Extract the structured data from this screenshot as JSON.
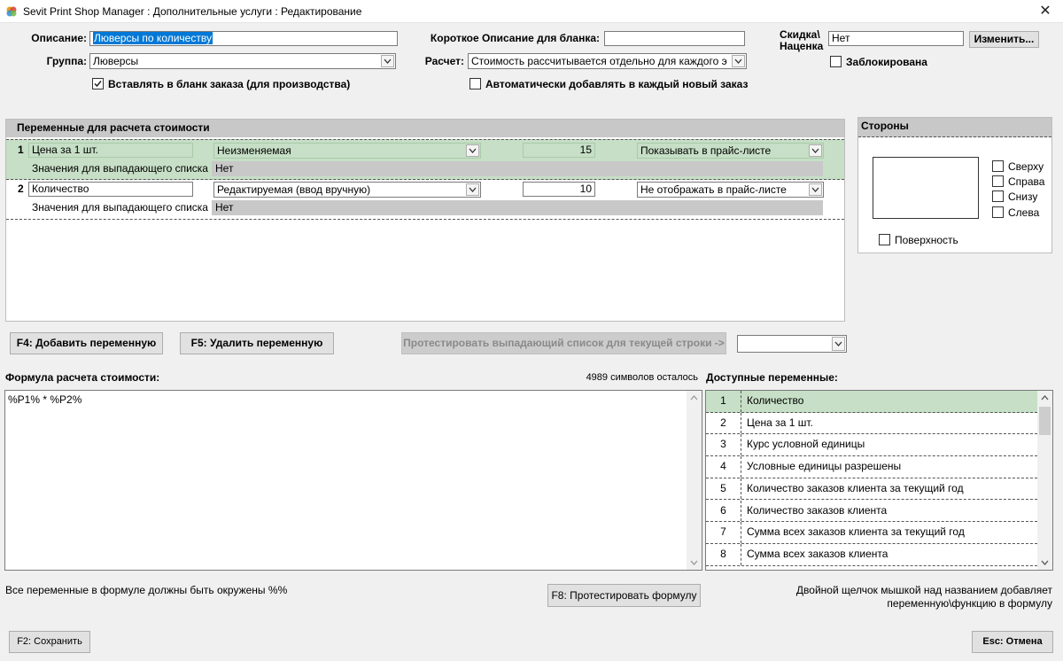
{
  "window": {
    "title": "Sevit Print Shop Manager : Дополнительные услуги : Редактирование",
    "close_glyph": "✕"
  },
  "form": {
    "description_label": "Описание:",
    "description_value": "Люверсы по количеству",
    "group_label": "Группа:",
    "group_value": "Люверсы",
    "short_desc_label": "Короткое Описание для бланка:",
    "short_desc_value": "",
    "calc_label": "Расчет:",
    "calc_value": "Стоимость рассчитывается отдельно для каждого э",
    "discount_label_line1": "Скидка\\",
    "discount_label_line2": "Наценка",
    "discount_value": "Нет",
    "change_button": "Изменить...",
    "blocked_label": "Заблокирована",
    "blocked_checked": false,
    "insert_label": "Вставлять в бланк заказа (для производства)",
    "insert_checked": true,
    "auto_add_label": "Автоматически добавлять в каждый новый заказ",
    "auto_add_checked": false
  },
  "variables_panel": {
    "header": "Переменные для расчета стоимости",
    "rows": [
      {
        "num": "1",
        "name": "Цена за 1 шт.",
        "type": "Неизменяемая",
        "value": "15",
        "pricelist": "Показывать в прайс-листе",
        "dropdown_label": "Значения для выпадающего списка",
        "dropdown_value": "Нет",
        "highlight": true
      },
      {
        "num": "2",
        "name": "Количество",
        "type": "Редактируемая (ввод вручную)",
        "value": "10",
        "pricelist": "Не отображать в прайс-листе",
        "dropdown_label": "Значения для выпадающего списка",
        "dropdown_value": "Нет",
        "highlight": false
      }
    ]
  },
  "sides_panel": {
    "header": "Стороны",
    "top": "Сверху",
    "right": "Справа",
    "bottom": "Снизу",
    "left": "Слева",
    "surface": "Поверхность"
  },
  "buttons": {
    "add_variable": "F4: Добавить переменную",
    "delete_variable": "F5: Удалить переменную",
    "test_dropdown": "Протестировать выпадающий список для текущей строки ->",
    "test_formula": "F8: Протестировать формулу",
    "save": "F2: Сохранить",
    "cancel": "Esc: Отмена"
  },
  "formula": {
    "label": "Формула расчета стоимости:",
    "chars_left": "4989 символов осталось",
    "value": "%P1% * %P2%",
    "hint": "Все переменные в формуле должны быть окружены %%"
  },
  "available_vars": {
    "label": "Доступные переменные:",
    "hint_line1": "Двойной щелчок мышкой над названием добавляет",
    "hint_line2": "переменную\\функцию в формулу",
    "items": [
      {
        "num": "1",
        "name": "Количество"
      },
      {
        "num": "2",
        "name": "Цена за 1 шт."
      },
      {
        "num": "3",
        "name": "Курс условной единицы"
      },
      {
        "num": "4",
        "name": "Условные единицы разрешены"
      },
      {
        "num": "5",
        "name": "Количество заказов клиента за текущий год"
      },
      {
        "num": "6",
        "name": "Количество заказов клиента"
      },
      {
        "num": "7",
        "name": "Сумма всех заказов клиента за текущий год"
      },
      {
        "num": "8",
        "name": "Сумма всех заказов клиента"
      }
    ]
  },
  "colors": {
    "highlight": "#c6dfc6",
    "highlight_border": "#a9cba9",
    "selection": "#0078d7",
    "panel_gray": "#c8c8c8"
  },
  "icons": {
    "app": "sevit-app-icon",
    "dropdown": "chevron-down-icon",
    "check": "check-icon"
  }
}
